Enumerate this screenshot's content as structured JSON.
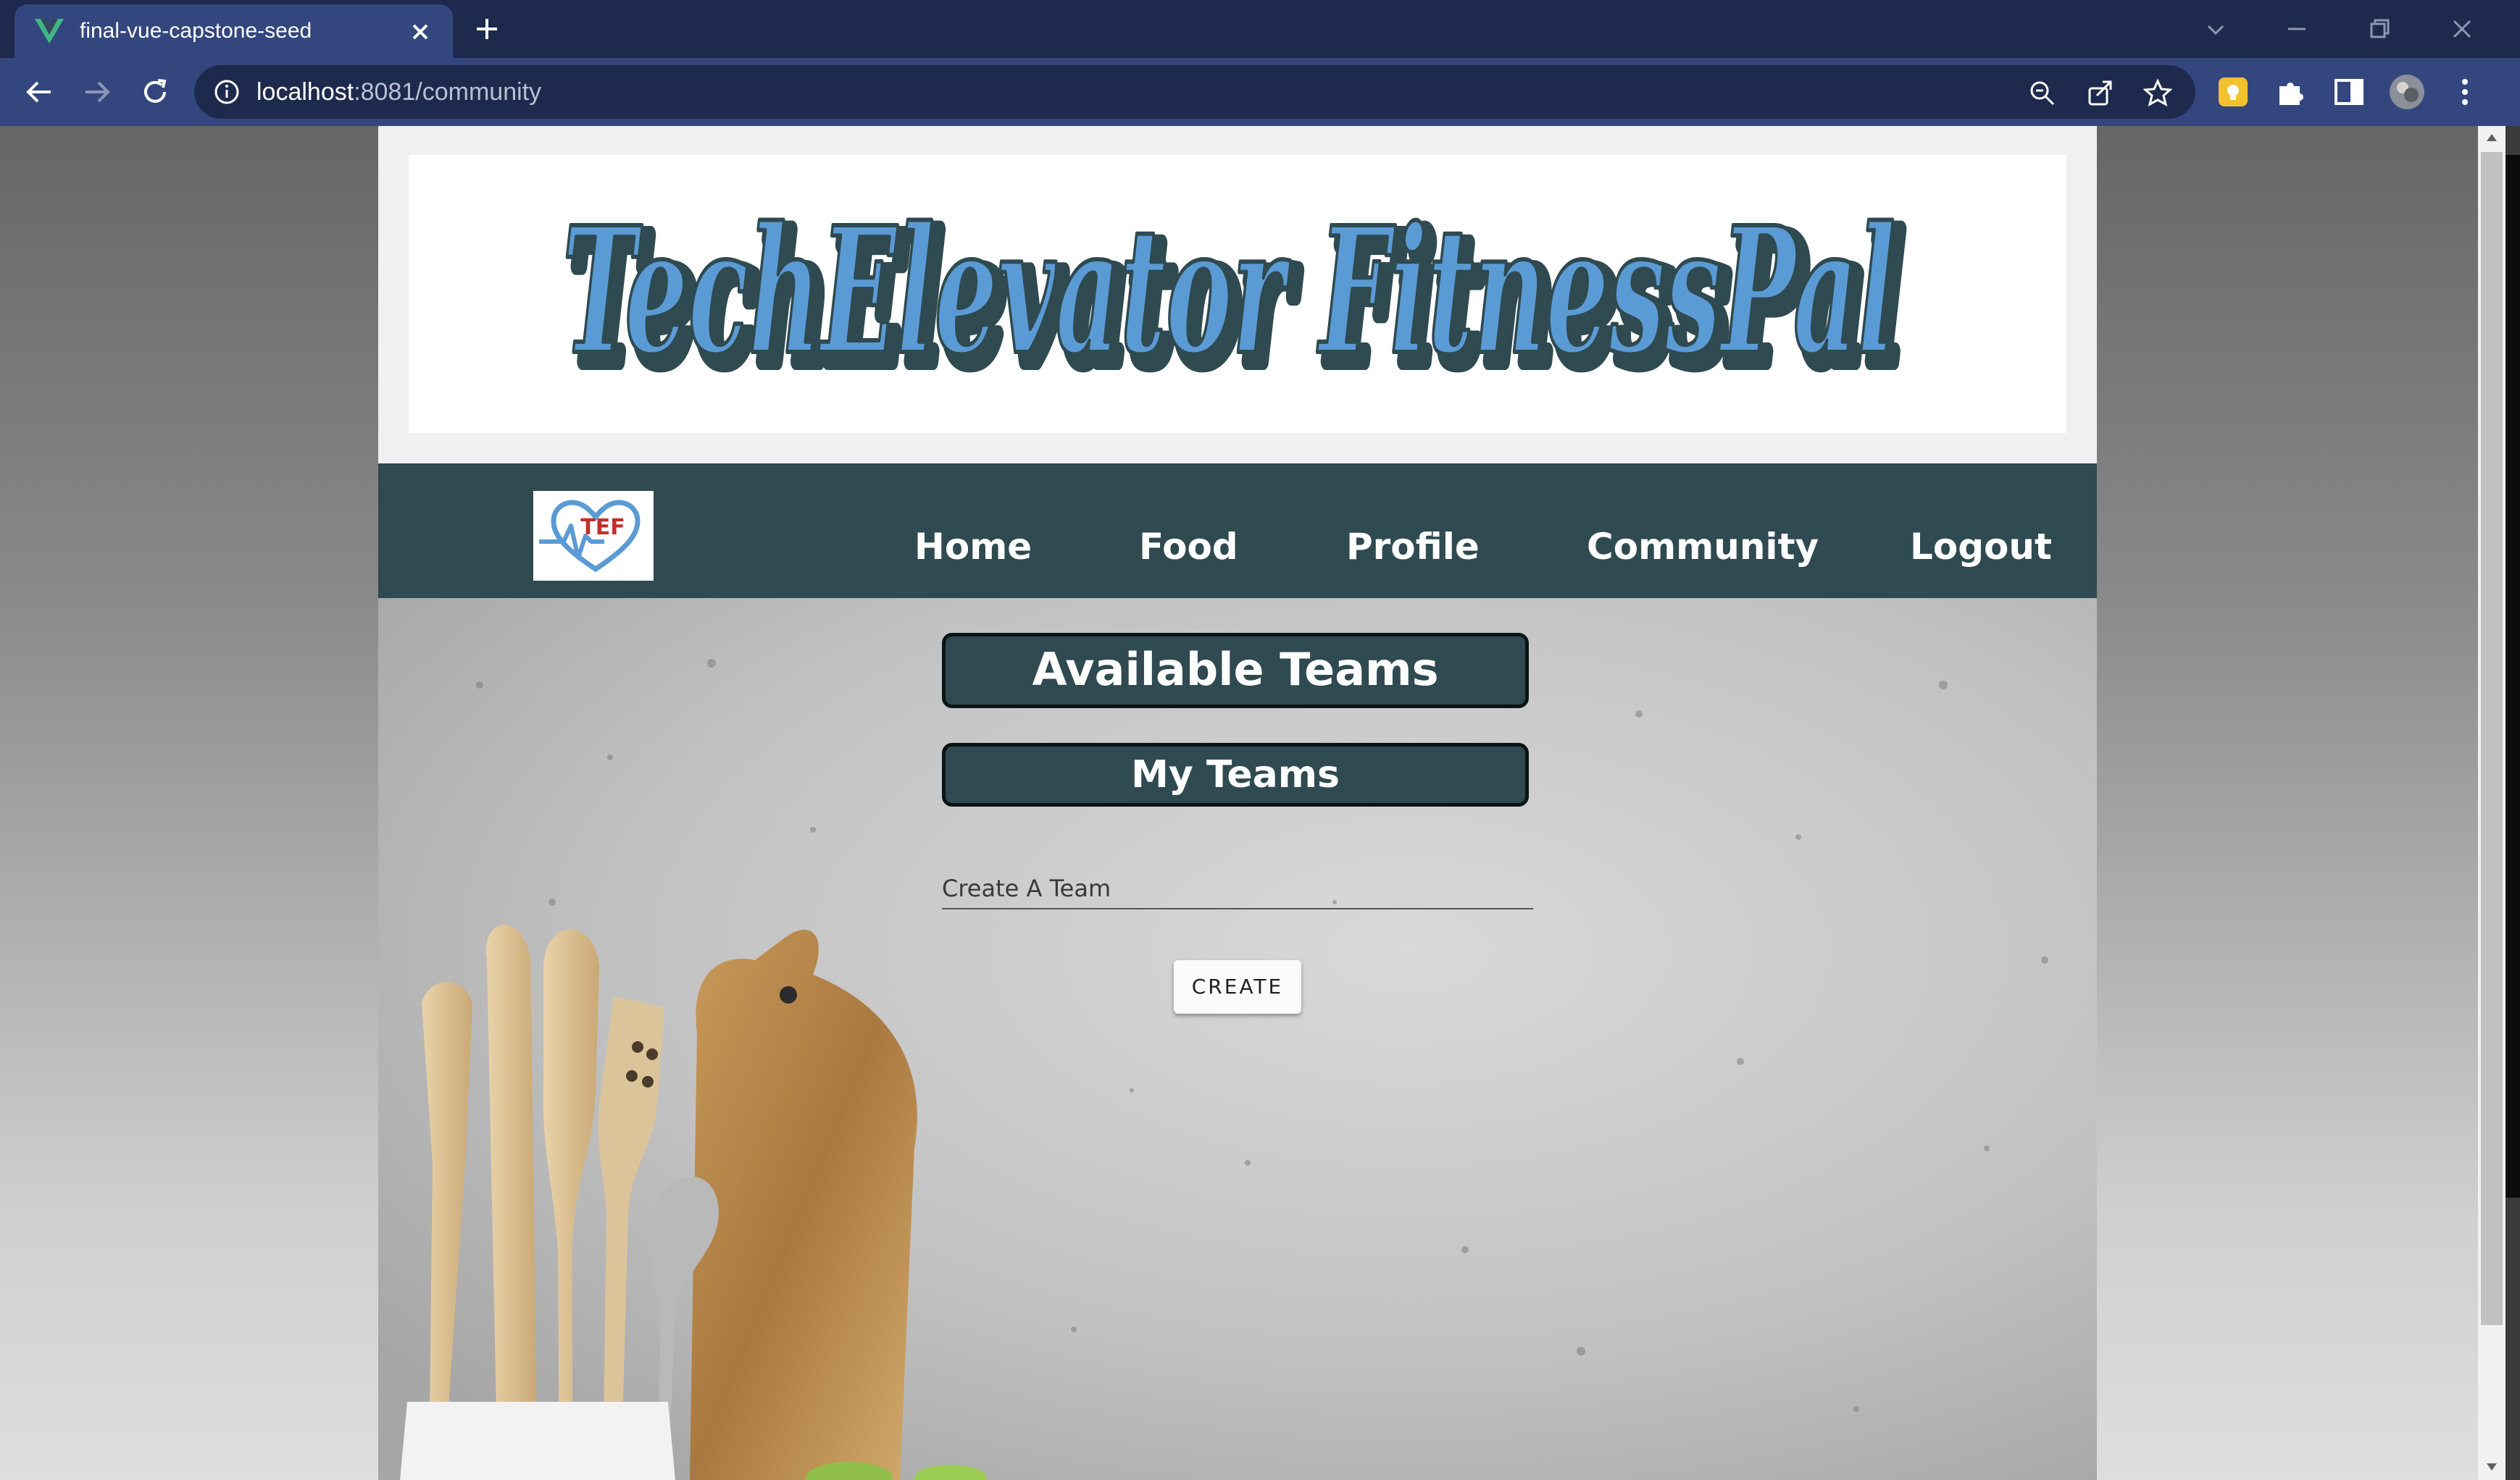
{
  "browser": {
    "tab_title": "final-vue-capstone-seed",
    "url_host": "localhost",
    "url_rest": ":8081/community",
    "favicon": "vue-icon"
  },
  "site": {
    "logo_text": "TechElevator FitnessPal",
    "nav_logo_text": "TEF",
    "nav": [
      "Home",
      "Food",
      "Profile",
      "Community",
      "Logout"
    ]
  },
  "community": {
    "available_teams": "Available Teams",
    "my_teams": "My Teams",
    "create_field_label": "Create A Team",
    "create_button": "CREATE"
  },
  "colors": {
    "nav_bg": "#2f4a50",
    "logo_blue": "#5b9bd5",
    "logo_outline": "#2f4a50",
    "browser_frame": "#1e2a4d"
  }
}
